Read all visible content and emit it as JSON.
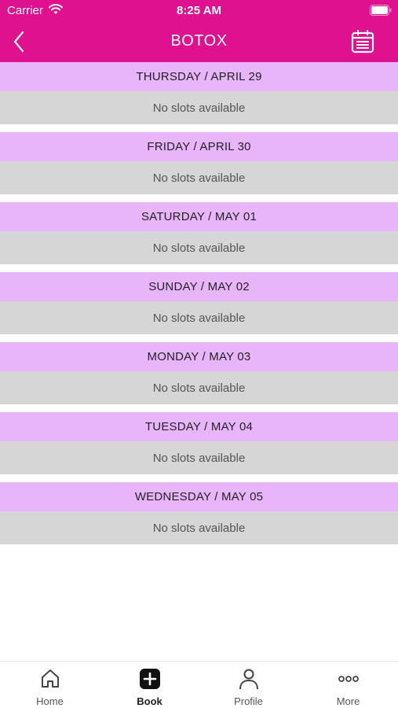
{
  "status_bar": {
    "carrier": "Carrier",
    "time": "8:25 AM"
  },
  "nav": {
    "title": "BOTOX",
    "back_icon": "chevron-left-icon",
    "calendar_icon": "calendar-icon"
  },
  "days": [
    {
      "header": "THURSDAY / APRIL 29",
      "slots": "No slots available"
    },
    {
      "header": "FRIDAY / APRIL 30",
      "slots": "No slots available"
    },
    {
      "header": "SATURDAY / MAY 01",
      "slots": "No slots available"
    },
    {
      "header": "SUNDAY / MAY 02",
      "slots": "No slots available"
    },
    {
      "header": "MONDAY / MAY 03",
      "slots": "No slots available"
    },
    {
      "header": "TUESDAY / MAY 04",
      "slots": "No slots available"
    },
    {
      "header": "WEDNESDAY / MAY 05",
      "slots": "No slots available"
    }
  ],
  "tabs": [
    {
      "label": "Home",
      "icon": "home-icon",
      "active": false
    },
    {
      "label": "Book",
      "icon": "plus-square-icon",
      "active": true
    },
    {
      "label": "Profile",
      "icon": "person-icon",
      "active": false
    },
    {
      "label": "More",
      "icon": "more-dots-icon",
      "active": false
    }
  ],
  "colors": {
    "brand": "#e0118f",
    "day_header": "#e8b5fa",
    "slot_bg": "#d6d6d6"
  }
}
